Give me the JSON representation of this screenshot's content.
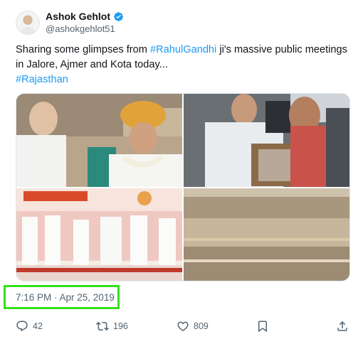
{
  "author": {
    "display_name": "Ashok Gehlot",
    "handle": "@ashokgehlot51",
    "verified": true,
    "avatar": "avatar-photo"
  },
  "tweet": {
    "text_before": "Sharing some glimpses from ",
    "mention_tag": "#RahulGandhi",
    "text_after": " ji's massive public meetings in Jalore, Ajmer and Kota today...",
    "tag_line": "#Rajasthan"
  },
  "media": {
    "photos": [
      "photo-1",
      "photo-2",
      "photo-3",
      "photo-4"
    ]
  },
  "timestamp": "7:16 PM · Apr 25, 2019",
  "actions": {
    "reply_count": "42",
    "retweet_count": "196",
    "like_count": "809"
  },
  "colors": {
    "hashtag": "#1d9bf0",
    "highlight_box": "#35e01c",
    "secondary_text": "#536471"
  }
}
